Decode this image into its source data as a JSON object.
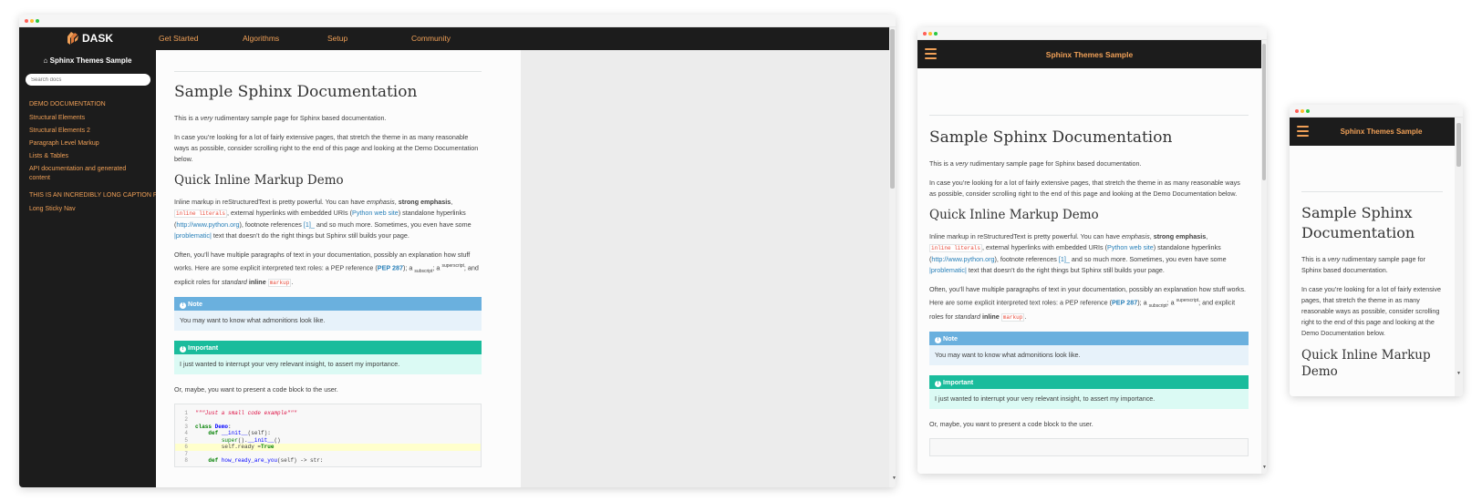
{
  "brand": "DASK",
  "nav": [
    "Get Started",
    "Algorithms",
    "Setup",
    "Community"
  ],
  "sidebar": {
    "title": "Sphinx Themes Sample",
    "search_placeholder": "Search docs",
    "caption1": "DEMO DOCUMENTATION",
    "items": [
      "Structural Elements",
      "Structural Elements 2",
      "Paragraph Level Markup",
      "Lists & Tables",
      "API documentation and generated content"
    ],
    "caption2": "THIS IS AN INCREDIBLY LONG CAPTION FOR A NAVIGATION MENU",
    "items2": [
      "Long Sticky Nav"
    ]
  },
  "mobile_title": "Sphinx Themes Sample",
  "doc": {
    "h1": "Sample Sphinx Documentation",
    "p1_a": "This is a ",
    "p1_em": "very",
    "p1_b": " rudimentary sample page for Sphinx based documentation.",
    "p2": "In case you’re looking for a lot of fairly extensive pages, that stretch the theme in as many reasonable ways as possible, consider scrolling right to the end of this page and looking at the Demo Documentation below.",
    "h2": "Quick Inline Markup Demo",
    "p3_a": "Inline markup in reStructuredText is pretty powerful. You can have ",
    "p3_em": "emphasis",
    "p3_b": ", ",
    "p3_strong": "strong emphasis",
    "p3_c": ",",
    "p3_lit": "inline literals",
    "p3_d": ", external hyperlinks with embedded URIs (",
    "p3_link1": "Python web site",
    "p3_e": ") standalone hyperlinks (",
    "p3_link2": "http://www.python.org",
    "p3_f": "), footnote references ",
    "p3_fn": "[1]_",
    "p3_g": " and so much more. Sometimes, you even have some ",
    "p3_link3": "|problematic|",
    "p3_h": " text that doesn’t do the right things but Sphinx still builds your page.",
    "p4_a": "Often, you’ll have multiple paragraphs of text in your documentation, possibly an explanation how stuff works. Here are some explicit interpreted text roles: a PEP reference (",
    "p4_pep": "PEP 287",
    "p4_b": "); a ",
    "p4_sub": "subscript",
    "p4_c": "; a ",
    "p4_sup": "superscript",
    "p4_d": "; and explicit roles for ",
    "p4_em": "standard",
    "p4_e": " ",
    "p4_strong": "inline",
    "p4_f": " ",
    "p4_lit": "markup",
    "p4_g": ".",
    "note_title": "Note",
    "note_body": "You may want to know what admonitions look like.",
    "imp_title": "Important",
    "imp_body": "I just wanted to interrupt your very relevant insight, to assert my importance.",
    "p5": "Or, maybe, you want to present a code block to the user.",
    "code_lines": [
      {
        "n": "1",
        "t": "\"\"\"Just a small code example\"\"\""
      },
      {
        "n": "2",
        "t": ""
      },
      {
        "n": "3",
        "t": "class Demo:"
      },
      {
        "n": "4",
        "t": "    def __init__(self):"
      },
      {
        "n": "5",
        "t": "        super().__init__()"
      },
      {
        "n": "6",
        "t": "        self.ready = True"
      },
      {
        "n": "7",
        "t": ""
      },
      {
        "n": "8",
        "t": "    def how_ready_are_you(self) -> str:"
      }
    ],
    "h1_phone": "Sample Sphinx Documentation",
    "h2_phone": "Quick Inline Markup Demo"
  },
  "colors": {
    "accent": "#f0a057",
    "nav_bg": "#1c1c1c",
    "note": "#6ab0de",
    "important": "#1abc9c",
    "link": "#2980b9"
  }
}
